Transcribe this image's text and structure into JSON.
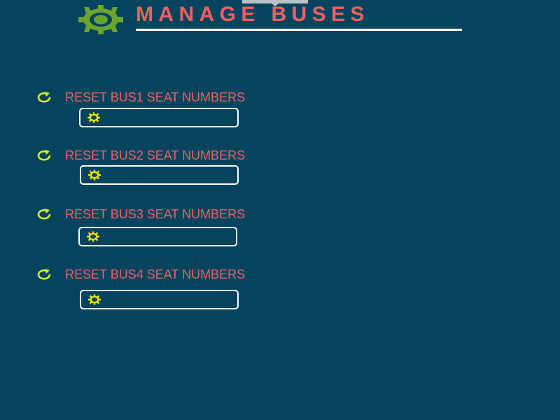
{
  "header": {
    "title": "MANAGE BUSES",
    "icon": "gear-icon",
    "icon_color": "#6aa42f",
    "title_color": "#f16161"
  },
  "colors": {
    "background": "#04445f",
    "accent": "#f16161",
    "icon_yellow": "#d8ee25",
    "field_border": "#ffffff"
  },
  "buses": [
    {
      "label": "RESET BUS1 SEAT NUMBERS",
      "icon": "refresh-icon",
      "field_icon": "gear-icon"
    },
    {
      "label": "RESET BUS2 SEAT NUMBERS",
      "icon": "refresh-icon",
      "field_icon": "gear-icon"
    },
    {
      "label": "RESET BUS3 SEAT NUMBERS",
      "icon": "refresh-icon",
      "field_icon": "gear-icon"
    },
    {
      "label": "RESET BUS4 SEAT NUMBERS",
      "icon": "refresh-icon",
      "field_icon": "gear-icon"
    }
  ]
}
